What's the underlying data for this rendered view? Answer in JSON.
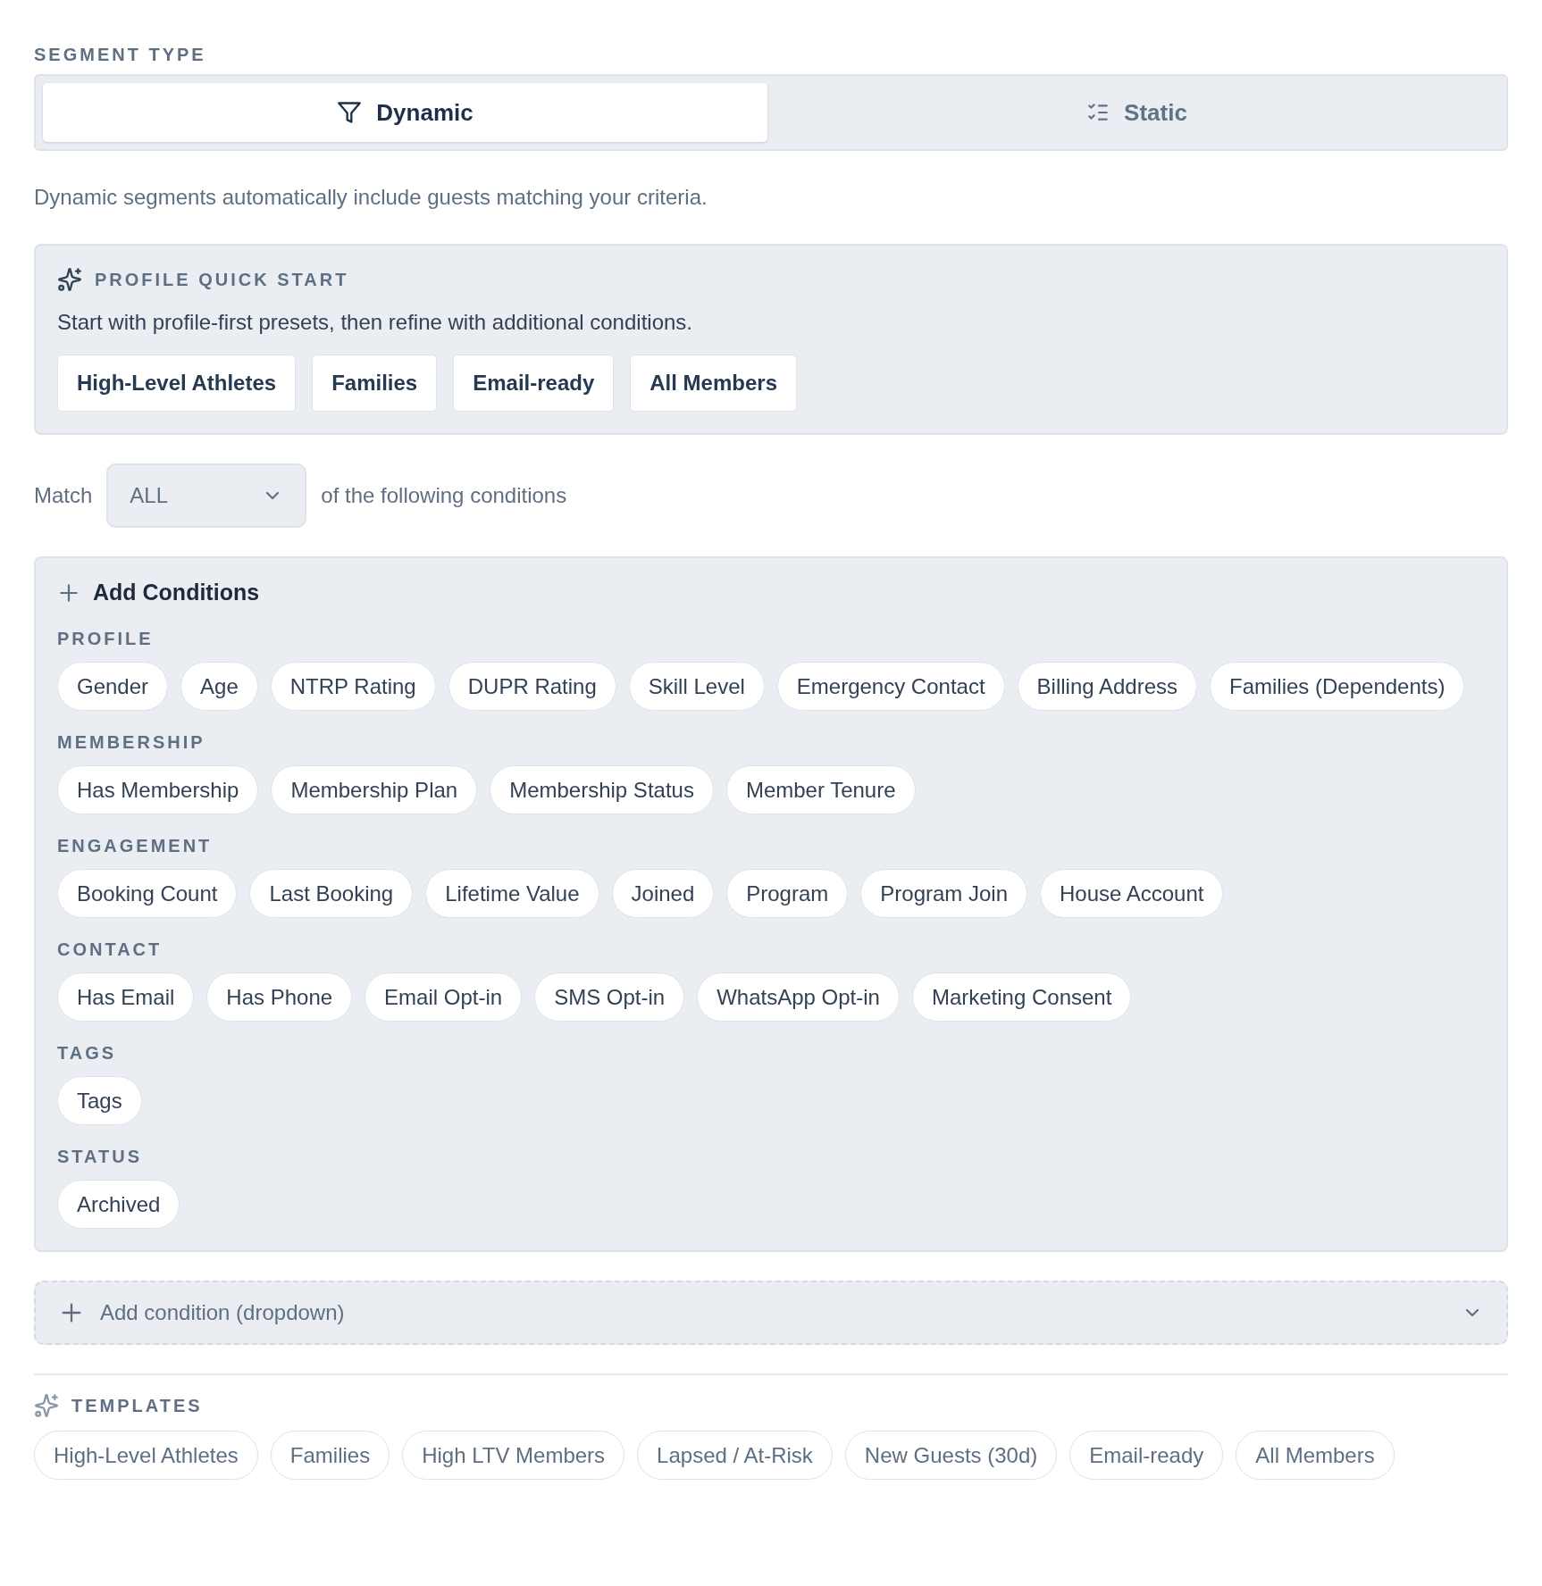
{
  "segment_type": {
    "label": "SEGMENT TYPE",
    "tabs": [
      {
        "label": "Dynamic",
        "kind": "filter",
        "selected": true
      },
      {
        "label": "Static",
        "kind": "checklist",
        "selected": false
      }
    ]
  },
  "description": "Dynamic segments automatically include guests matching your criteria.",
  "quick_start": {
    "title": "PROFILE QUICK START",
    "text": "Start with profile-first presets, then refine with additional conditions.",
    "presets": [
      "High-Level Athletes",
      "Families",
      "Email-ready",
      "All Members"
    ]
  },
  "match": {
    "label": "Match",
    "value": "ALL",
    "suffix": "of the following conditions"
  },
  "add_conditions": {
    "title": "Add Conditions",
    "groups": [
      {
        "label": "PROFILE",
        "items": [
          "Gender",
          "Age",
          "NTRP Rating",
          "DUPR Rating",
          "Skill Level",
          "Emergency Contact",
          "Billing Address",
          "Families (Dependents)"
        ]
      },
      {
        "label": "MEMBERSHIP",
        "items": [
          "Has Membership",
          "Membership Plan",
          "Membership Status",
          "Member Tenure"
        ]
      },
      {
        "label": "ENGAGEMENT",
        "items": [
          "Booking Count",
          "Last Booking",
          "Lifetime Value",
          "Joined",
          "Program",
          "Program Join",
          "House Account"
        ]
      },
      {
        "label": "CONTACT",
        "items": [
          "Has Email",
          "Has Phone",
          "Email Opt-in",
          "SMS Opt-in",
          "WhatsApp Opt-in",
          "Marketing Consent"
        ]
      },
      {
        "label": "TAGS",
        "items": [
          "Tags"
        ]
      },
      {
        "label": "STATUS",
        "items": [
          "Archived"
        ]
      }
    ]
  },
  "condition_dropdown": {
    "placeholder": "Add condition (dropdown)"
  },
  "templates": {
    "title": "TEMPLATES",
    "items": [
      "High-Level Athletes",
      "Families",
      "High LTV Members",
      "Lapsed / At-Risk",
      "New Guests (30d)",
      "Email-ready",
      "All Members"
    ]
  }
}
